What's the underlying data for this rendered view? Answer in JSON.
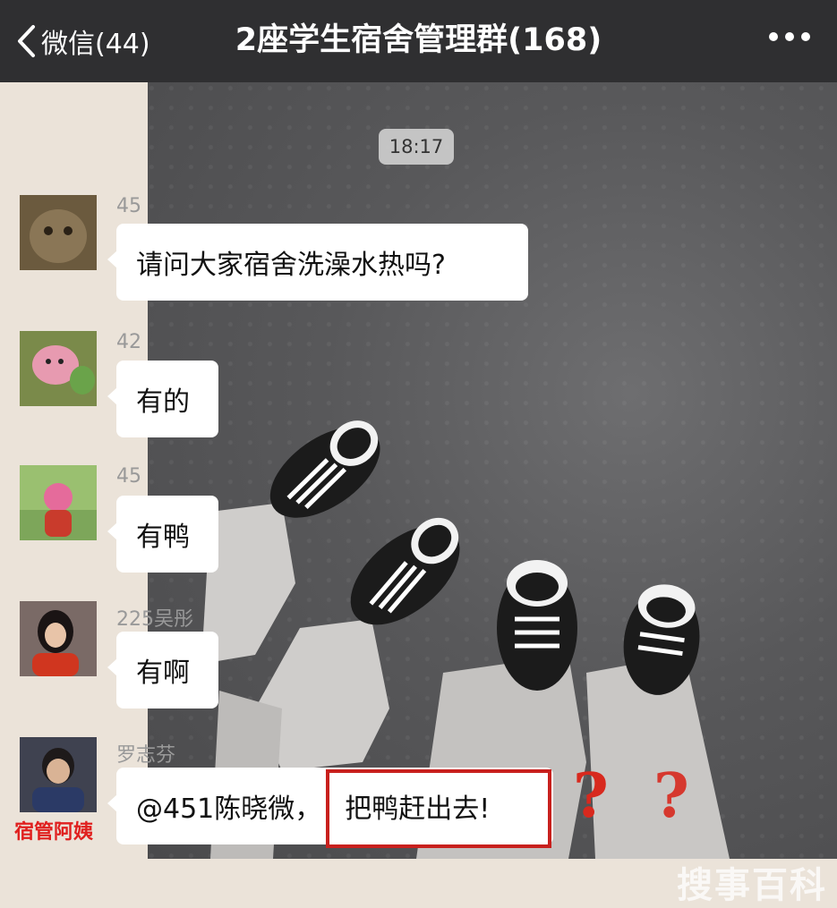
{
  "header": {
    "back_label": "微信(44)",
    "title": "2座学生宿舍管理群(168)"
  },
  "chat": {
    "timestamp": "18:17",
    "messages": [
      {
        "nick": "45",
        "text": "请问大家宿舍洗澡水热吗?"
      },
      {
        "nick": "42",
        "text": "有的"
      },
      {
        "nick": "45",
        "text": "有鸭"
      },
      {
        "nick": "225吴彤",
        "text": "有啊"
      },
      {
        "nick": "罗志芬",
        "mention": "@451陈晓微，",
        "text": "把鸭赶出去!"
      }
    ],
    "aunt_label": "宿管阿姨",
    "question_marks": [
      "?",
      "?"
    ],
    "watermark": "搜事百科"
  },
  "colors": {
    "header_bg": "#2f2f31",
    "chat_bg": "#ebe3d9",
    "highlight_red": "#c8201d"
  }
}
